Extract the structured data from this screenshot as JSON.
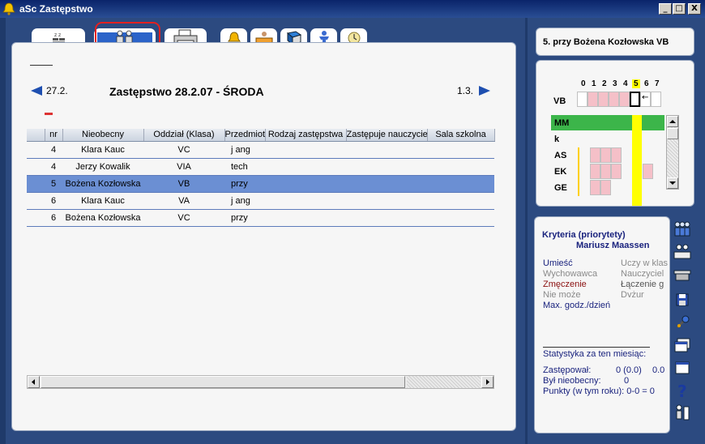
{
  "window": {
    "title": "aSc Zastępstwo",
    "minimize_label": "_",
    "maximize_label": "□",
    "close_label": "X"
  },
  "nav": {
    "prev_label": "27.2.",
    "next_label": "1.3.",
    "page_title": "Zastępstwo 28.2.07 - ŚRODA"
  },
  "table": {
    "columns": [
      "nr",
      "Nieobecny",
      "Oddział (Klasa)",
      "Przedmiot",
      "Rodzaj zastępstwa",
      "Zastępuje nauczyciel",
      "Sala szkolna"
    ],
    "rows": [
      [
        "4",
        "Klara Kauc",
        "VC",
        "j ang",
        "",
        "",
        ""
      ],
      [
        "4",
        "Jerzy Kowalik",
        "VIA",
        "tech",
        "",
        "",
        ""
      ],
      [
        "5",
        "Bożena Kozłowska",
        "VB",
        "przy",
        "",
        "",
        ""
      ],
      [
        "6",
        "Klara Kauc",
        "VA",
        "j ang",
        "",
        "",
        ""
      ],
      [
        "6",
        "Bożena Kozłowska",
        "VC",
        "przy",
        "",
        "",
        ""
      ]
    ],
    "selected_row": 2
  },
  "teacher_header": "5. przy Bożena Kozłowska VB",
  "mini_timetable": {
    "periods": [
      "0",
      "1",
      "2",
      "3",
      "4",
      "5",
      "6",
      "7"
    ],
    "highlight_period": "5",
    "rows": [
      "VB",
      "MM",
      "k",
      "AS",
      "EK",
      "GE"
    ]
  },
  "criteria": {
    "title": "Kryteria (priorytety)",
    "teacher": "Mariusz Maassen",
    "left": [
      "Umieść",
      "Wychowawca",
      "Zmęczenie",
      "Nie może",
      "Max. godz./dzień"
    ],
    "right": [
      "Uczy w klas",
      "Nauczyciel",
      "Łączenie g",
      "Dyżur"
    ],
    "stats_title": "Statystyka za ten miesiąc:",
    "stat_zast_label": "Zastępował:",
    "stat_zast_value": "0 (0.0)",
    "stat_zast_extra": "0.0",
    "stat_byl_label": "Był nieobecny:",
    "stat_byl_value": "0",
    "stat_punkty": "Punkty (w tym roku): 0-0 = 0"
  },
  "colors": {
    "accent": "#2b63c9",
    "selected": "#6b8fd3",
    "pink": "#f5c0c8",
    "green": "#3cb54a",
    "yellow": "#ffff00"
  }
}
